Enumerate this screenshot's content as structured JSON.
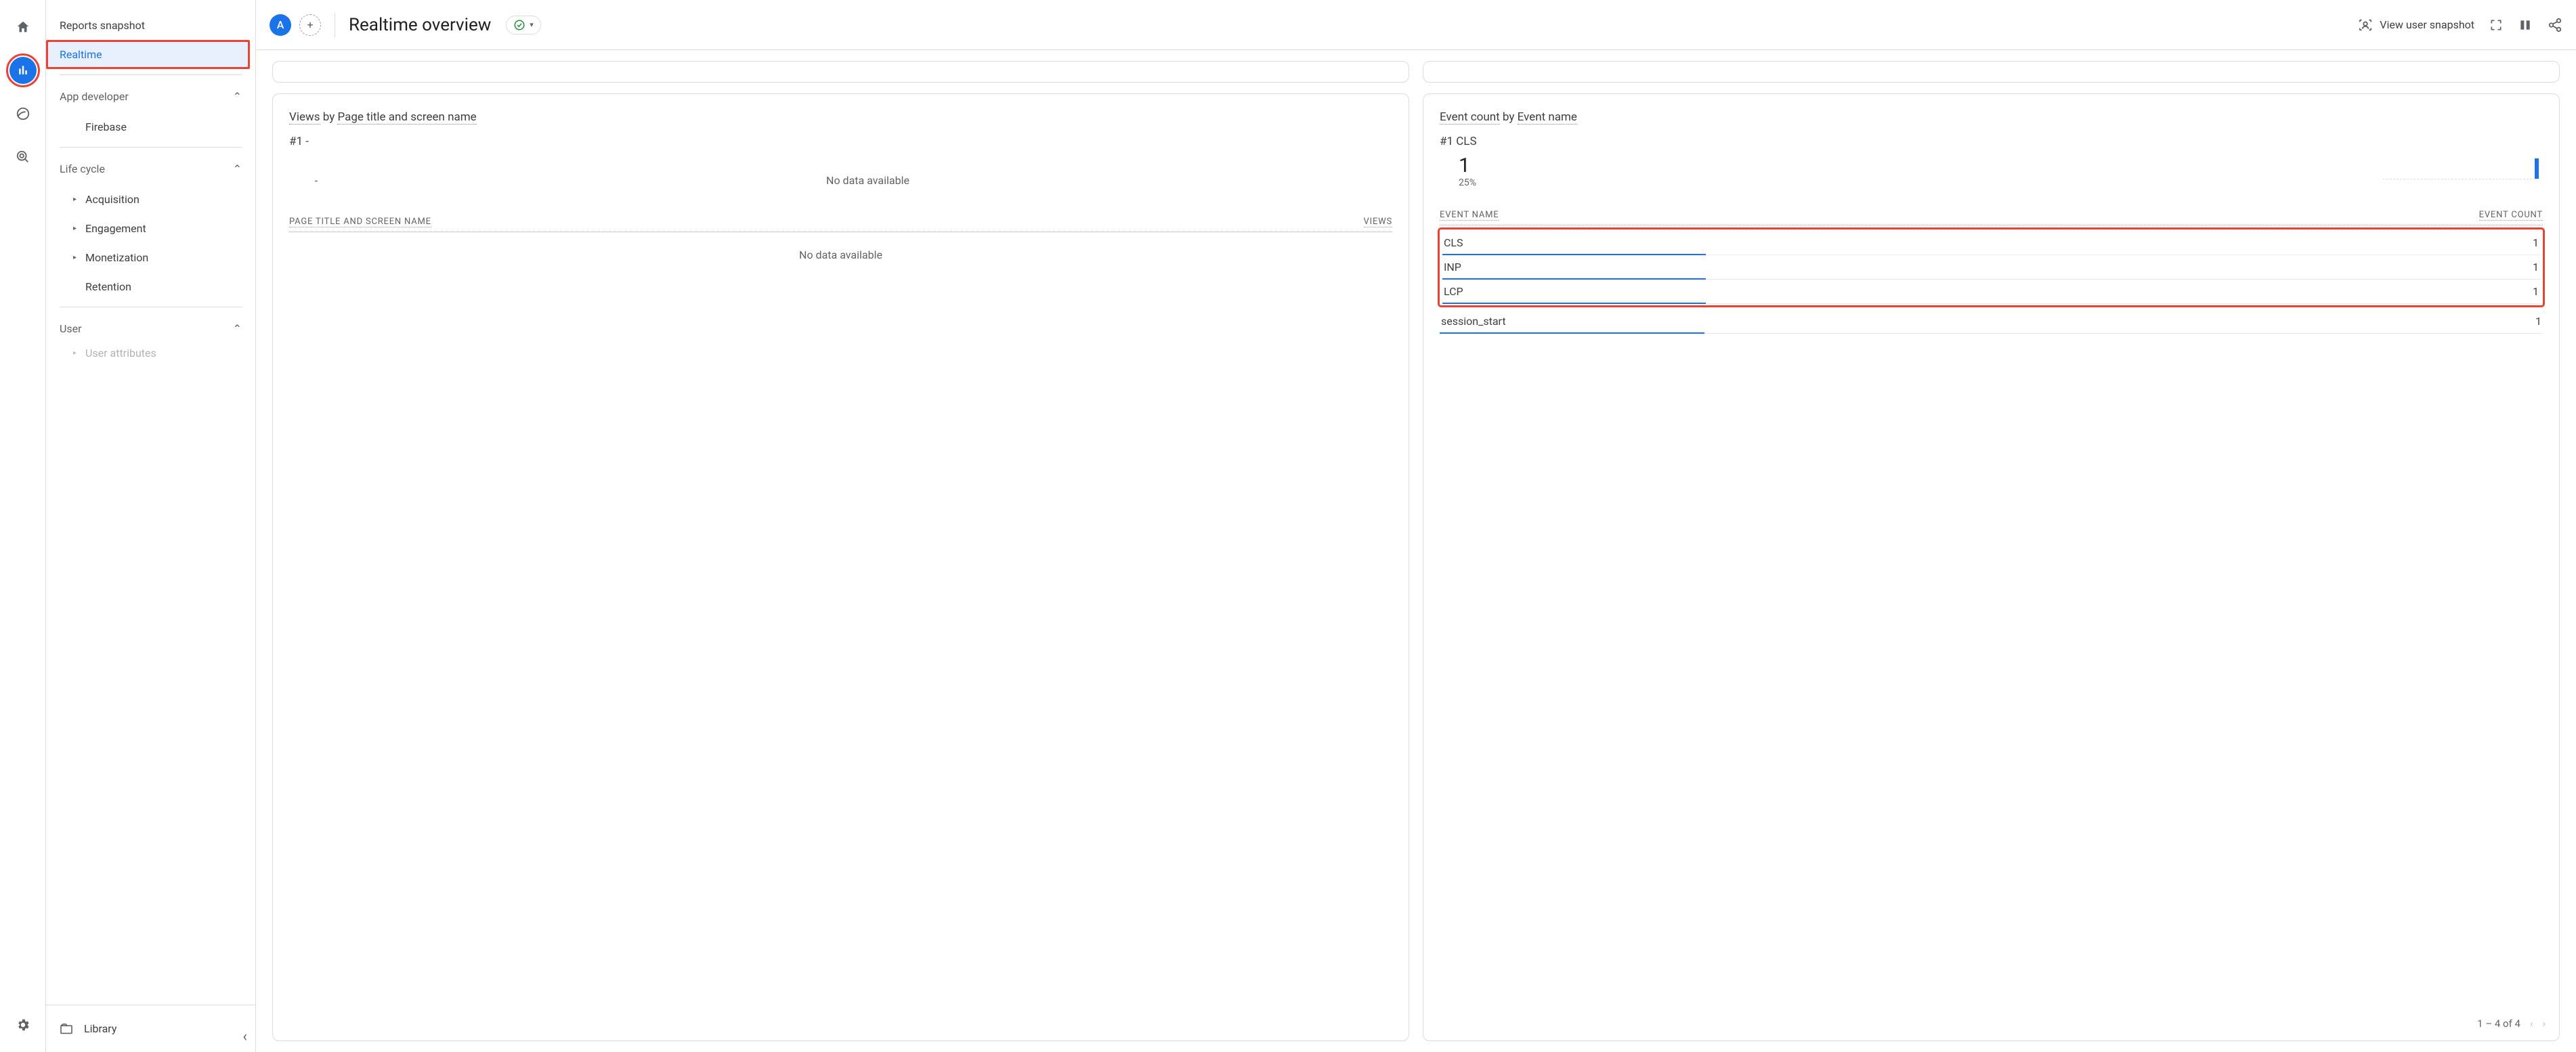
{
  "rail": {
    "home": "home",
    "reports": "reports",
    "explore": "explore",
    "advertising": "advertising",
    "admin": "admin"
  },
  "nav": {
    "snapshot": "Reports snapshot",
    "realtime": "Realtime",
    "app_dev": "App developer",
    "firebase": "Firebase",
    "life_cycle": "Life cycle",
    "acquisition": "Acquisition",
    "engagement": "Engagement",
    "monetization": "Monetization",
    "retention": "Retention",
    "user": "User",
    "user_attributes": "User attributes",
    "library": "Library"
  },
  "header": {
    "chip": "A",
    "title": "Realtime overview",
    "snapshot_btn": "View user snapshot"
  },
  "views_card": {
    "title_prefix": "Views",
    "title_by": " by ",
    "title_dim": "Page title and screen name",
    "rank": "#1  -",
    "nodata_top": "No data available",
    "dash": "-",
    "col1": "PAGE TITLE AND SCREEN NAME",
    "col2": "VIEWS",
    "nodata_body": "No data available"
  },
  "events_card": {
    "title_prefix": "Event count",
    "title_by": " by ",
    "title_dim": "Event name",
    "rank": "#1  CLS",
    "big": "1",
    "pct": "25%",
    "col1": "EVENT NAME",
    "col2": "EVENT COUNT",
    "rows": [
      {
        "name": "CLS",
        "count": "1",
        "bar": 24
      },
      {
        "name": "INP",
        "count": "1",
        "bar": 24
      },
      {
        "name": "LCP",
        "count": "1",
        "bar": 24
      },
      {
        "name": "session_start",
        "count": "1",
        "bar": 24
      }
    ],
    "pager": "1 – 4 of 4"
  },
  "chart_data": {
    "type": "bar",
    "title": "Event count by Event name",
    "xlabel": "Event name",
    "ylabel": "Event count",
    "categories": [
      "CLS",
      "INP",
      "LCP",
      "session_start"
    ],
    "values": [
      1,
      1,
      1,
      1
    ],
    "ylim": [
      0,
      1
    ]
  }
}
